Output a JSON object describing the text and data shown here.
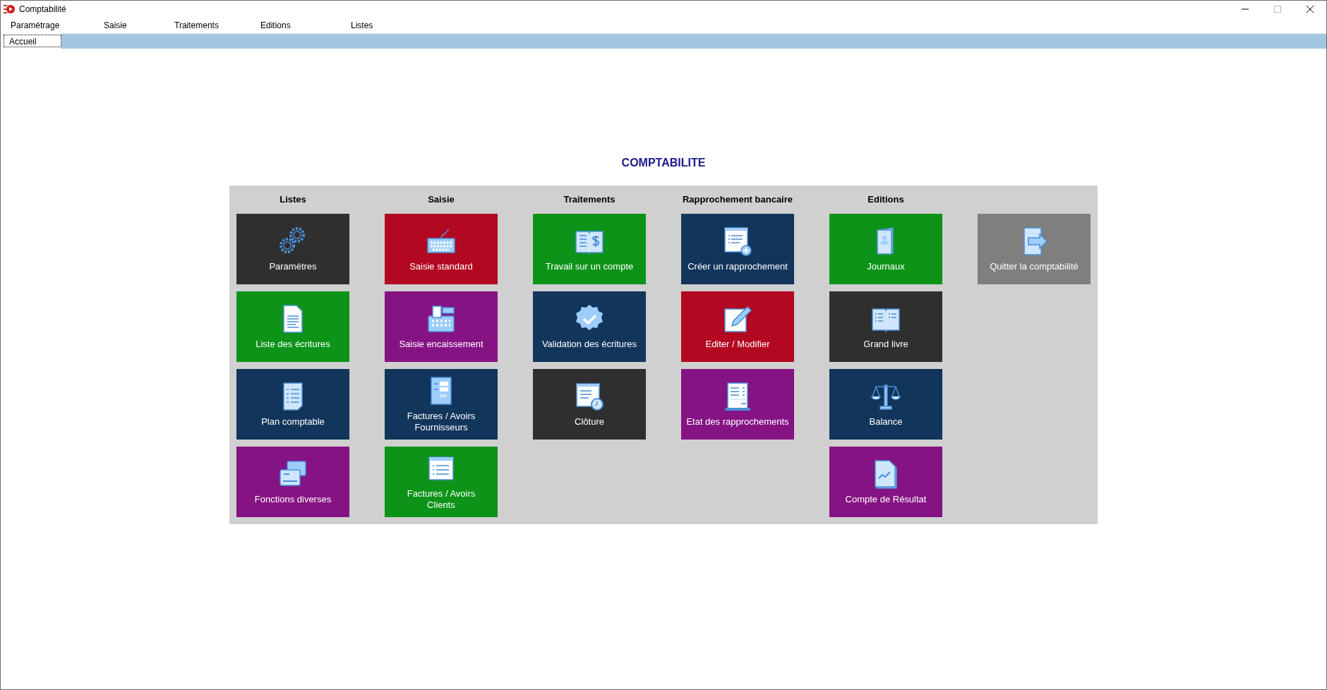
{
  "window": {
    "title": "Comptabilité"
  },
  "menu": [
    "Paramétrage",
    "Saisie",
    "Traitements",
    "Editions",
    "Listes"
  ],
  "tabs": [
    {
      "label": "Accueil",
      "selected": true
    }
  ],
  "heading": "COMPTABILITE",
  "columns": [
    {
      "header": "Listes",
      "tiles": [
        {
          "label": "Paramétres",
          "color": "#2f2f2f"
        },
        {
          "label": "Liste des écritures",
          "color": "#0d9318"
        },
        {
          "label": "Plan comptable",
          "color": "#12355b"
        },
        {
          "label": "Fonctions diverses",
          "color": "#861384"
        }
      ]
    },
    {
      "header": "Saisie",
      "tiles": [
        {
          "label": "Saisie standard",
          "color": "#b30821"
        },
        {
          "label": "Saisie encaissement",
          "color": "#861384"
        },
        {
          "label": "Factures / Avoirs\nFournisseurs",
          "color": "#12355b"
        },
        {
          "label": "Factures / Avoirs\nClients",
          "color": "#0d9318"
        }
      ]
    },
    {
      "header": "Traitements",
      "tiles": [
        {
          "label": "Travail sur un compte",
          "color": "#0d9318"
        },
        {
          "label": "Validation des écritures",
          "color": "#12355b"
        },
        {
          "label": "Clôture",
          "color": "#2f2f2f"
        }
      ]
    },
    {
      "header": "Rapprochement bancaire",
      "tiles": [
        {
          "label": "Créer un rapprochement",
          "color": "#12355b"
        },
        {
          "label": "Editer / Modifier",
          "color": "#b30821"
        },
        {
          "label": "Etat des rapprochements",
          "color": "#861384"
        }
      ]
    },
    {
      "header": "Editions",
      "tiles": [
        {
          "label": "Journaux",
          "color": "#0d9318"
        },
        {
          "label": "Grand livre",
          "color": "#2f2f2f"
        },
        {
          "label": "Balance",
          "color": "#12355b"
        },
        {
          "label": "Compte de Résultat",
          "color": "#861384"
        }
      ]
    },
    {
      "tiles": [
        {
          "label": "Quitter la comptabilité",
          "color": "#7f7f7f"
        }
      ]
    }
  ]
}
